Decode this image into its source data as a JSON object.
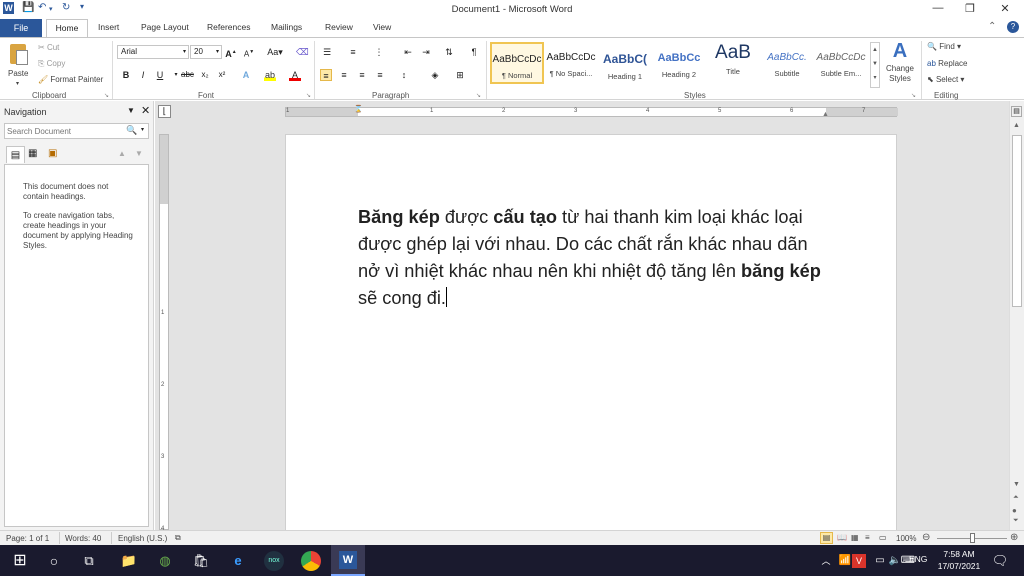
{
  "window": {
    "title": "Document1  -  Microsoft Word",
    "controls": {
      "minimize": "—",
      "restore": "❐",
      "close": "✕"
    }
  },
  "tabs": {
    "file": "File",
    "home": "Home",
    "insert": "Insert",
    "page_layout": "Page Layout",
    "references": "References",
    "mailings": "Mailings",
    "review": "Review",
    "view": "View"
  },
  "ribbon": {
    "clipboard": {
      "paste": "Paste",
      "cut": "Cut",
      "copy": "Copy",
      "format_painter": "Format Painter",
      "label": "Clipboard"
    },
    "font": {
      "name": "Arial",
      "size": "20",
      "label": "Font"
    },
    "paragraph": {
      "label": "Paragraph"
    },
    "styles": {
      "label": "Styles",
      "items": [
        {
          "preview": "AaBbCcDc",
          "name": "¶ Normal"
        },
        {
          "preview": "AaBbCcDc",
          "name": "¶ No Spaci..."
        },
        {
          "preview": "AaBbC(",
          "name": "Heading 1"
        },
        {
          "preview": "AaBbCc",
          "name": "Heading 2"
        },
        {
          "preview": "AaB",
          "name": "Title"
        },
        {
          "preview": "AaBbCc.",
          "name": "Subtitle"
        },
        {
          "preview": "AaBbCcDc",
          "name": "Subtle Em..."
        }
      ],
      "change_styles": "Change Styles"
    },
    "editing": {
      "find": "Find",
      "replace": "Replace",
      "select": "Select",
      "label": "Editing"
    }
  },
  "navigation": {
    "title": "Navigation",
    "search_placeholder": "Search Document",
    "msg1": "This document does not contain headings.",
    "msg2": "To create navigation tabs, create headings in your document by applying Heading Styles."
  },
  "document": {
    "p1_bold1": "Băng kép",
    "p1_t1": " được ",
    "p1_bold2": "cấu tạo",
    "p1_t2": " từ hai thanh kim loại khác loại được ghép lại với nhau. Do các chất rắn khác nhau dãn nở vì nhiệt khác nhau nên khi nhiệt độ tăng lên ",
    "p1_bold3": "băng kép",
    "p1_t3": " sẽ cong đi."
  },
  "ruler": {
    "numbers": [
      "1",
      "1",
      "2",
      "3",
      "4",
      "5",
      "6",
      "7"
    ]
  },
  "status": {
    "page": "Page: 1 of 1",
    "words": "Words: 40",
    "language": "English (U.S.)",
    "zoom": "100%"
  },
  "taskbar": {
    "lang": "ENG",
    "time": "7:58 AM",
    "date": "17/07/2021"
  }
}
